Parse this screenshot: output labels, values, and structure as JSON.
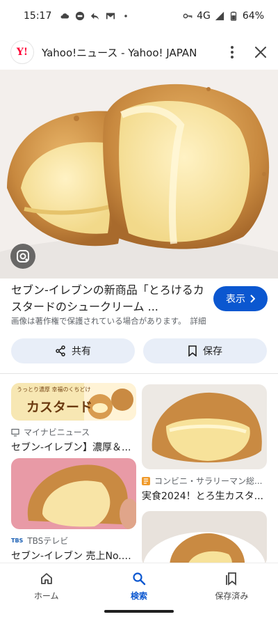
{
  "status_bar": {
    "time": "15:17",
    "network": "4G",
    "battery": "64%",
    "icons": [
      "cloud-icon",
      "line-icon",
      "reply-icon",
      "gmail-icon",
      "dot-icon",
      "key-icon",
      "signal-icon",
      "battery-icon"
    ]
  },
  "header": {
    "favicon_text": "Y!",
    "title": "Yahoo!ニュース - Yahoo! JAPAN"
  },
  "hero": {
    "alt": "シュークリーム"
  },
  "caption": {
    "title": "セブン-イレブンの新商品「とろけるカスタードのシュークリーム ...",
    "visit_label": "表示",
    "notice": "画像は著作権で保護されている場合があります。",
    "detail_link": "詳細"
  },
  "actions": {
    "share_label": "共有",
    "save_label": "保存"
  },
  "cards": [
    {
      "banner_top": "うっとり濃厚 幸福のくちどけ",
      "banner_main": "カスタード",
      "source": "マイナビニュース",
      "title": "セブン-イレブン】濃厚＆..."
    },
    {
      "source": "コンビニ・サラリーマン総...",
      "title": "実食2024！とろ生カスタ..."
    },
    {
      "source": "TBSテレビ",
      "source_logo": "TBS",
      "title": "セブン-イレブン 売上No.1..."
    },
    {
      "source": "",
      "title": ""
    }
  ],
  "bottom_nav": {
    "home": "ホーム",
    "search": "検索",
    "saved": "保存済み"
  },
  "colors": {
    "accent": "#0b57d0",
    "chip_bg": "#e8eef8",
    "yahoo_red": "#ff0033"
  }
}
